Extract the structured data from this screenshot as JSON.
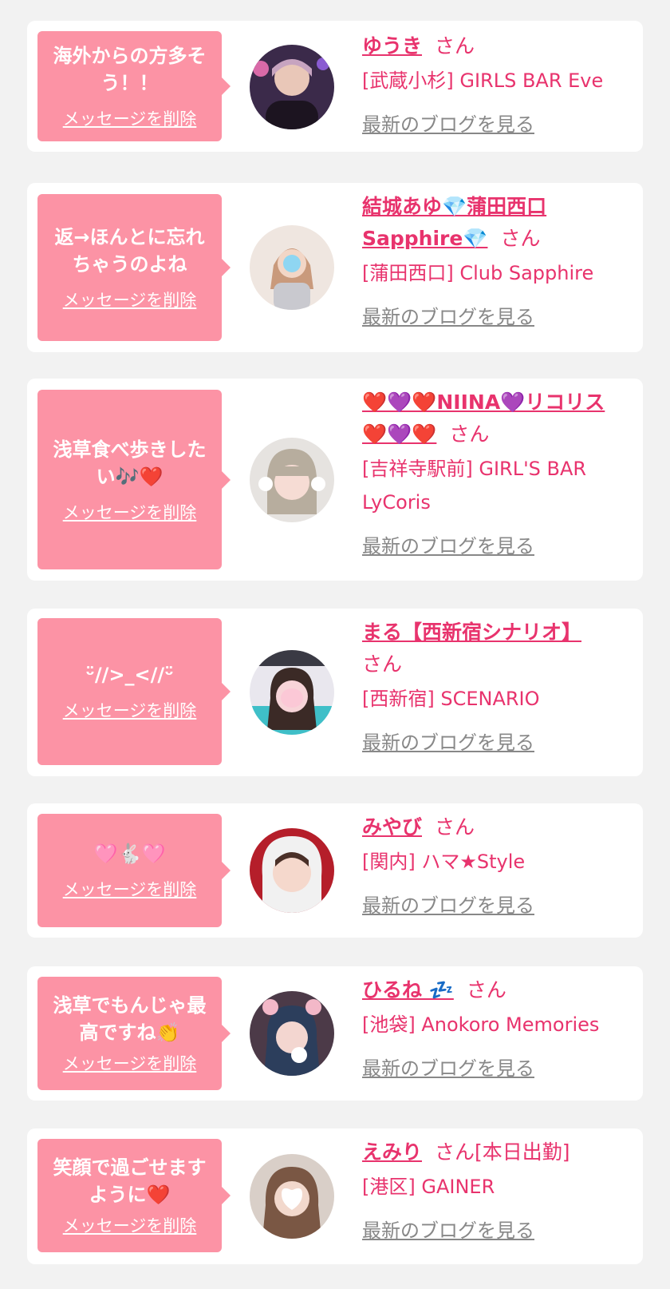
{
  "delete_label": "メッセージを削除",
  "blog_label": "最新のブログを見る",
  "san_label": "さん",
  "colors": {
    "accent": "#e8336d",
    "bubble": "#fc93a5",
    "background": "#f2f2f2",
    "card": "#ffffff",
    "link_gray": "#888888"
  },
  "messages": [
    {
      "text": "海外からの方多そう！！",
      "name": "ゆうき",
      "suffix": "さん",
      "shop": "[武蔵小杉] GIRLS BAR Eve",
      "avatar_icon": "cast-avatar-photo"
    },
    {
      "text": "返→ほんとに忘れちゃうのよね",
      "name": "結城あゆ💎蒲田西口Sapphire💎",
      "suffix": "さん",
      "shop": "[蒲田西口] Club Sapphire",
      "avatar_icon": "cast-avatar-photo"
    },
    {
      "text": "浅草食べ歩きしたい🎶❤️",
      "name": "❤️💜❤️NIINA💜リコリス❤️💜❤️",
      "suffix": "さん",
      "shop": "[吉祥寺駅前] GIRL'S BAR LyCoris",
      "avatar_icon": "cast-avatar-photo"
    },
    {
      "text": "ᵕ̈//>_<//ᵕ̈",
      "name": "まる【西新宿シナリオ】",
      "suffix": "さん",
      "shop": "[西新宿] SCENARIO",
      "avatar_icon": "cast-avatar-photo"
    },
    {
      "text": "🩷🐇🩷",
      "name": "みやび",
      "suffix": "さん",
      "shop": "[関内] ハマ★Style",
      "avatar_icon": "cast-avatar-photo"
    },
    {
      "text": "浅草でもんじゃ最高ですね👏",
      "name": "ひるね 💤",
      "suffix": "さん",
      "shop": "[池袋] Anokoro Memories",
      "avatar_icon": "cast-avatar-photo"
    },
    {
      "text": "笑顔で過ごせますように❤️",
      "name": "えみり",
      "suffix": "さん[本日出勤]",
      "shop": "[港区] GAINER",
      "avatar_icon": "cast-avatar-photo"
    }
  ]
}
